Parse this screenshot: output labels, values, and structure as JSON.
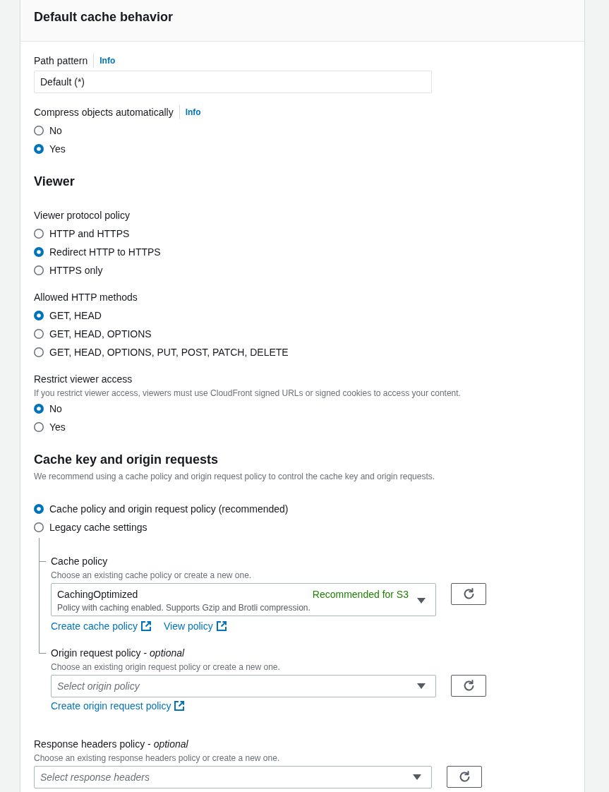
{
  "panel": {
    "title": "Default cache behavior"
  },
  "path_pattern": {
    "label": "Path pattern",
    "info": "Info",
    "value": "Default (*)"
  },
  "compress_objects": {
    "label": "Compress objects automatically",
    "info": "Info",
    "options": [
      {
        "label": "No",
        "selected": false
      },
      {
        "label": "Yes",
        "selected": true
      }
    ]
  },
  "viewer": {
    "heading": "Viewer",
    "fields": [
      {
        "label": "Viewer protocol policy",
        "options": [
          {
            "label": "HTTP and HTTPS",
            "selected": false
          },
          {
            "label": "Redirect HTTP to HTTPS",
            "selected": true
          },
          {
            "label": "HTTPS only",
            "selected": false
          }
        ]
      },
      {
        "label": "Allowed HTTP methods",
        "options": [
          {
            "label": "GET, HEAD",
            "selected": true
          },
          {
            "label": "GET, HEAD, OPTIONS",
            "selected": false
          },
          {
            "label": "GET, HEAD, OPTIONS, PUT, POST, PATCH, DELETE",
            "selected": false
          }
        ]
      },
      {
        "label": "Restrict viewer access",
        "description": "If you restrict viewer access, viewers must use CloudFront signed URLs or signed cookies to access your content.",
        "options": [
          {
            "label": "No",
            "selected": true
          },
          {
            "label": "Yes",
            "selected": false
          }
        ]
      }
    ]
  },
  "cache_key": {
    "heading": "Cache key and origin requests",
    "description": "We recommend using a cache policy and origin request policy to control the cache key and origin requests.",
    "options": [
      {
        "label": "Cache policy and origin request policy (recommended)",
        "selected": true
      },
      {
        "label": "Legacy cache settings",
        "selected": false
      }
    ],
    "policies": [
      {
        "label": "Cache policy",
        "description": "Choose an existing cache policy or create a new one.",
        "select": {
          "value": "CachingOptimized",
          "tag": "Recommended for S3",
          "description": "Policy with caching enabled. Supports Gzip and Brotli compression."
        },
        "links": [
          "Create cache policy",
          "View policy"
        ]
      },
      {
        "label": "Origin request policy - *optional*",
        "description": "Choose an existing origin request policy or create a new one.",
        "select": {
          "placeholder": "Select origin policy"
        },
        "links": [
          "Create origin request policy"
        ]
      }
    ]
  },
  "response_headers_policy": {
    "label": "Response headers policy - *optional*",
    "description": "Choose an existing response headers policy or create a new one.",
    "select": {
      "placeholder": "Select response headers"
    }
  }
}
